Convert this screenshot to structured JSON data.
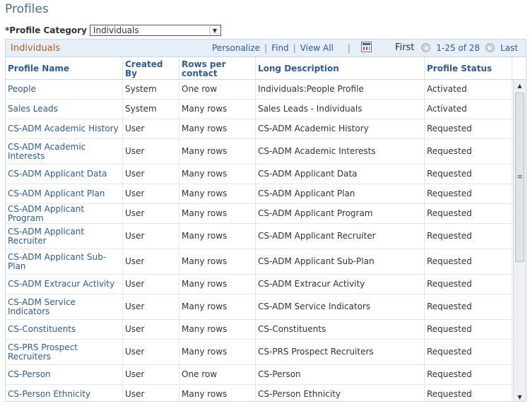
{
  "page": {
    "title": "Profiles"
  },
  "category": {
    "label": "*Profile Category",
    "selected": "Individuals"
  },
  "grid": {
    "title": "Individuals",
    "nav": {
      "personalize": "Personalize",
      "find": "Find",
      "view_all": "View All",
      "sep": "|"
    },
    "pager": {
      "first": "First",
      "range": "1-25 of 28",
      "last": "Last"
    },
    "columns": [
      "Profile Name",
      "Created By",
      "Rows per contact",
      "Long Description",
      "Profile Status"
    ],
    "rows": [
      [
        "People",
        "System",
        "One row",
        "Individuals:People Profile",
        "Activated"
      ],
      [
        "Sales Leads",
        "System",
        "Many rows",
        "Sales Leads - Individuals",
        "Activated"
      ],
      [
        "CS-ADM Academic History",
        "User",
        "Many rows",
        "CS-ADM Academic History",
        "Requested"
      ],
      [
        "CS-ADM Academic Interests",
        "User",
        "Many rows",
        "CS-ADM Academic Interests",
        "Requested"
      ],
      [
        "CS-ADM Applicant Data",
        "User",
        "Many rows",
        "CS-ADM Applicant Data",
        "Requested"
      ],
      [
        "CS-ADM Applicant Plan",
        "User",
        "Many rows",
        "CS-ADM Applicant Plan",
        "Requested"
      ],
      [
        "CS-ADM Applicant Program",
        "User",
        "Many rows",
        "CS-ADM Applicant Program",
        "Requested"
      ],
      [
        "CS-ADM Applicant Recruiter",
        "User",
        "Many rows",
        "CS-ADM Applicant Recruiter",
        "Requested"
      ],
      [
        "CS-ADM Applicant Sub-Plan",
        "User",
        "Many rows",
        "CS-ADM Applicant Sub-Plan",
        "Requested"
      ],
      [
        "CS-ADM Extracur Activity",
        "User",
        "Many rows",
        "CS-ADM Extracur Activity",
        "Requested"
      ],
      [
        "CS-ADM Service Indicators",
        "User",
        "Many rows",
        "CS-ADM Service Indicators",
        "Requested"
      ],
      [
        "CS-Constituents",
        "User",
        "Many rows",
        "CS-Constituents",
        "Requested"
      ],
      [
        "CS-PRS Prospect Recruiters",
        "User",
        "Many rows",
        "CS-PRS Prospect Recruiters",
        "Requested"
      ],
      [
        "CS-Person",
        "User",
        "One row",
        "CS-Person",
        "Requested"
      ],
      [
        "CS-Person Ethnicity",
        "User",
        "Many rows",
        "CS-Person Ethnicity",
        "Requested"
      ]
    ]
  },
  "colors": {
    "link": "#2d5b9c",
    "accent": "#b85b1a",
    "header_bg": "#e6eef7",
    "border": "#c9d6e6"
  },
  "icons": {
    "grid_download": "spreadsheet-icon",
    "prev": "arrow-left-icon",
    "next": "arrow-right-icon"
  }
}
